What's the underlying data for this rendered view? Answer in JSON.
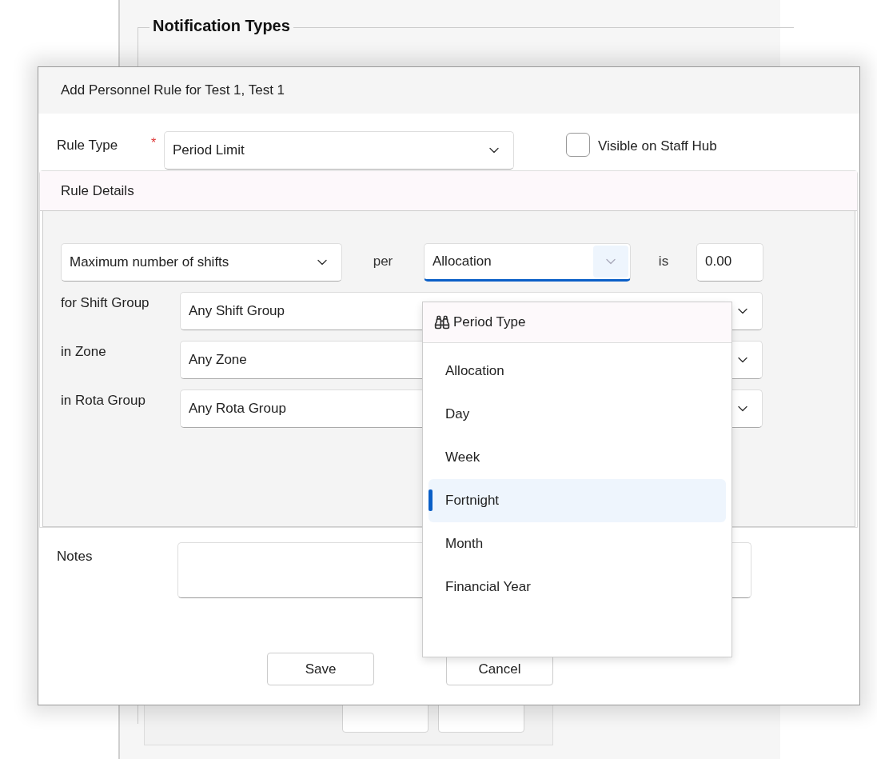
{
  "background": {
    "section_title": "Notification Types"
  },
  "dialog": {
    "title": "Add Personnel Rule for Test 1, Test 1",
    "rule_type": {
      "label": "Rule Type",
      "required_mark": "*",
      "value": "Period Limit"
    },
    "visible_on_staff_hub": {
      "label": "Visible on Staff Hub",
      "checked": false
    },
    "rule_details": {
      "title": "Rule Details",
      "measure": {
        "value": "Maximum number of shifts"
      },
      "per_label": "per",
      "period": {
        "value": "Allocation",
        "open": true
      },
      "is_label": "is",
      "amount": {
        "value": "0.00"
      },
      "filters": [
        {
          "label": "for Shift Group",
          "value": "Any Shift Group"
        },
        {
          "label": "in Zone",
          "value": "Any Zone"
        },
        {
          "label": "in Rota Group",
          "value": "Any Rota Group"
        }
      ]
    },
    "notes": {
      "label": "Notes"
    },
    "buttons": [
      "Save",
      "Cancel"
    ]
  },
  "period_menu": {
    "title": "Period Type",
    "options": [
      {
        "label": "Allocation",
        "selected": false
      },
      {
        "label": "Day",
        "selected": false
      },
      {
        "label": "Week",
        "selected": false
      },
      {
        "label": "Fortnight",
        "selected": true
      },
      {
        "label": "Month",
        "selected": false
      },
      {
        "label": "Financial Year",
        "selected": false
      }
    ]
  }
}
